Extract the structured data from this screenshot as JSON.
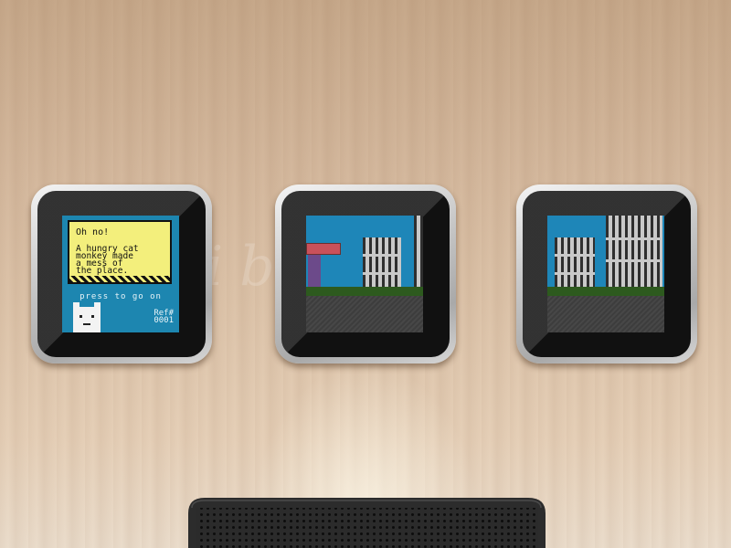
{
  "watermark": "iblaze",
  "screen1": {
    "title": "Oh no!",
    "message": "A hungry cat\nmonkey made\na mess of\nthe place.",
    "prompt": "press to go on",
    "ref_label": "Ref#",
    "ref_number": "0001",
    "icon": "cat-face-icon"
  },
  "colors": {
    "screen_background": "#1d86b0",
    "message_box": "#f3ef7c",
    "sky": "#1e86b8",
    "grass": "#2d5a1e",
    "road": "#3d3d3d",
    "sign": "#c9515a"
  }
}
